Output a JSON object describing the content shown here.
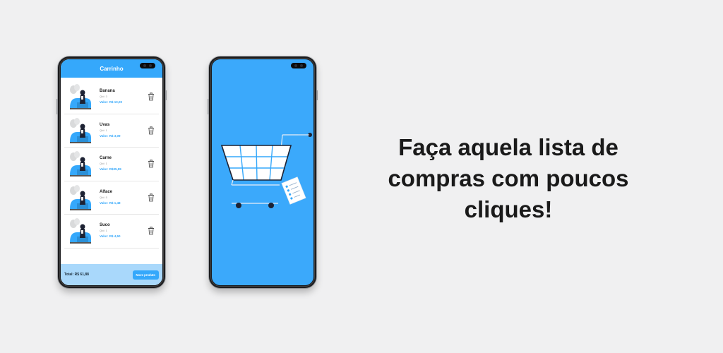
{
  "headline": "Faça aquela lista de compras com poucos cliques!",
  "app": {
    "title": "Carrinho",
    "items": [
      {
        "name": "Banana",
        "qty": "Qtd: 3",
        "value": "Valor: R$ 10,00"
      },
      {
        "name": "Uvas",
        "qty": "Qtd: 1",
        "value": "Valor: R$ 3,09"
      },
      {
        "name": "Carne",
        "qty": "Qtd: 1",
        "value": "Valor: R$35,99"
      },
      {
        "name": "Alface",
        "qty": "Qtd: 5",
        "value": "Valor: R$ 1,48"
      },
      {
        "name": "Suco",
        "qty": "Qtd: 1",
        "value": "Valor: R$ 4,50"
      }
    ],
    "total": "Total: R$ 61,88",
    "new_button": "Novo produto"
  },
  "colors": {
    "accent": "#35a8fb",
    "footer": "#a9d8fb",
    "background": "#f0f0f1"
  },
  "icons": [
    "trash-icon",
    "shopping-cart-icon",
    "checklist-icon",
    "person-illustration"
  ]
}
